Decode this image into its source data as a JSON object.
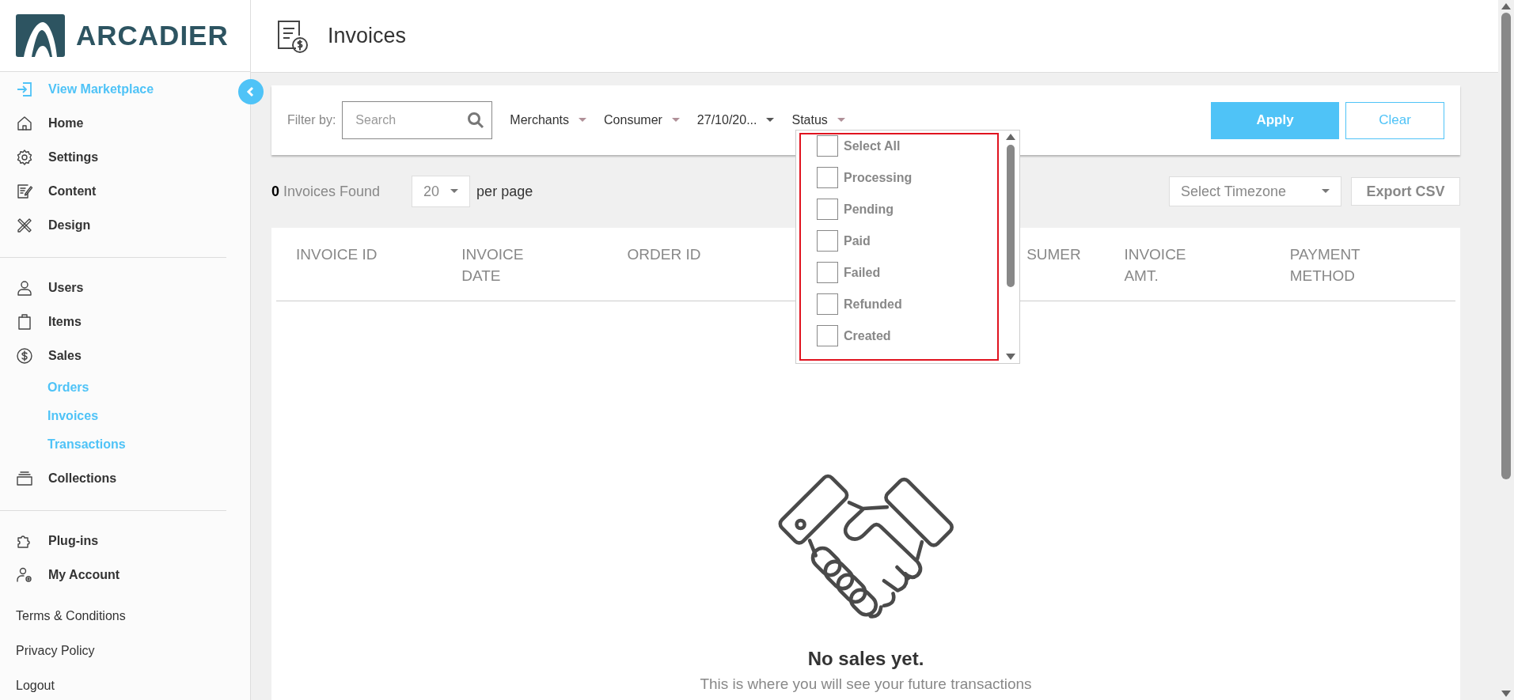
{
  "logo": {
    "text": "ARCADIER"
  },
  "page": {
    "title": "Invoices"
  },
  "sidebar": {
    "groups": [
      [
        {
          "label": "View Marketplace",
          "kind": "accent"
        },
        {
          "label": "Home",
          "kind": "plain"
        },
        {
          "label": "Settings",
          "kind": "plain"
        },
        {
          "label": "Content",
          "kind": "plain"
        },
        {
          "label": "Design",
          "kind": "plain"
        }
      ],
      [
        {
          "label": "Users",
          "kind": "plain"
        },
        {
          "label": "Items",
          "kind": "plain"
        },
        {
          "label": "Sales",
          "kind": "plain",
          "children": [
            "Orders",
            "Invoices",
            "Transactions"
          ]
        },
        {
          "label": "Collections",
          "kind": "plain"
        }
      ],
      [
        {
          "label": "Plug-ins",
          "kind": "plain"
        },
        {
          "label": "My Account",
          "kind": "plain"
        }
      ]
    ],
    "footer_links": [
      "Terms & Conditions",
      "Privacy Policy",
      "Logout"
    ]
  },
  "filter": {
    "label": "Filter by:",
    "search": {
      "placeholder": "Search"
    },
    "dropdowns": [
      "Merchants",
      "Consumer",
      "27/10/20...",
      "Status"
    ],
    "apply": "Apply",
    "clear": "Clear"
  },
  "status_menu": {
    "highlighted": true,
    "options": [
      {
        "label": "Select All",
        "checked": false
      },
      {
        "label": "Processing",
        "checked": false
      },
      {
        "label": "Pending",
        "checked": false
      },
      {
        "label": "Paid",
        "checked": false
      },
      {
        "label": "Failed",
        "checked": false
      },
      {
        "label": "Refunded",
        "checked": false
      },
      {
        "label": "Created",
        "checked": false
      }
    ]
  },
  "results": {
    "count": "0",
    "label": "Invoices Found",
    "per_page_value": "20",
    "per_page_label": "per page",
    "timezone": "Select Timezone",
    "export": "Export CSV"
  },
  "table": {
    "columns": [
      {
        "label": "INVOICE ID"
      },
      {
        "label": "INVOICE DATE"
      },
      {
        "label": "ORDER ID"
      },
      {
        "label": "SUMER"
      },
      {
        "label": "INVOICE AMT."
      },
      {
        "label": "PAYMENT METHOD"
      }
    ]
  },
  "empty_state": {
    "title": "No sales yet.",
    "text": "This is where you will see your future transactions"
  }
}
